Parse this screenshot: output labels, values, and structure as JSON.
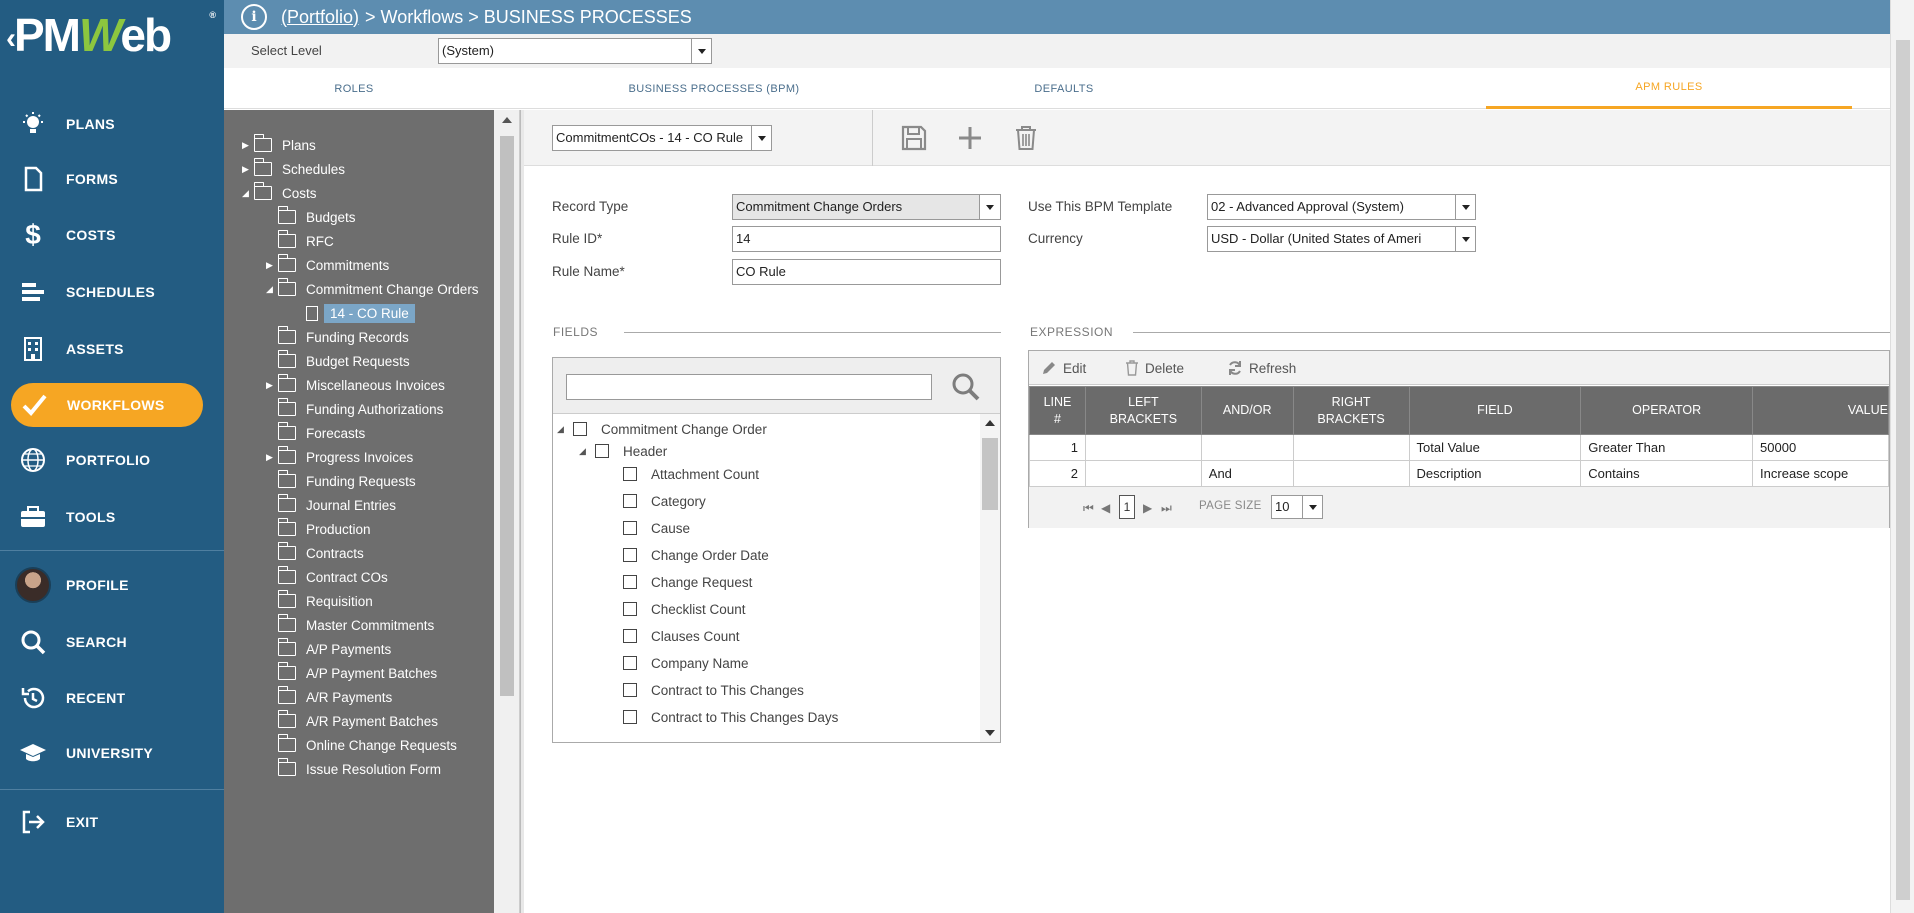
{
  "nav": {
    "items": [
      {
        "label": "PLANS",
        "icon": "lightbulb-icon"
      },
      {
        "label": "FORMS",
        "icon": "document-icon"
      },
      {
        "label": "COSTS",
        "icon": "dollar-icon"
      },
      {
        "label": "SCHEDULES",
        "icon": "schedule-bars-icon"
      },
      {
        "label": "ASSETS",
        "icon": "building-icon"
      },
      {
        "label": "WORKFLOWS",
        "icon": "checkmark-icon"
      },
      {
        "label": "PORTFOLIO",
        "icon": "globe-icon"
      },
      {
        "label": "TOOLS",
        "icon": "briefcase-icon"
      },
      {
        "label": "PROFILE",
        "icon": "avatar"
      },
      {
        "label": "SEARCH",
        "icon": "search-icon"
      },
      {
        "label": "RECENT",
        "icon": "history-icon"
      },
      {
        "label": "UNIVERSITY",
        "icon": "graduation-cap-icon"
      },
      {
        "label": "EXIT",
        "icon": "exit-icon"
      }
    ],
    "active": "WORKFLOWS",
    "logo_text": "PMWeb",
    "logo_mark": "®"
  },
  "header": {
    "portfolio_link": "(Portfolio)",
    "breadcrumb_rest": "> Workflows > BUSINESS PROCESSES"
  },
  "level": {
    "label": "Select Level",
    "value": "(System)"
  },
  "tabs": [
    {
      "label": "ROLES"
    },
    {
      "label": "BUSINESS PROCESSES (BPM)"
    },
    {
      "label": "DEFAULTS"
    },
    {
      "label": "APM RULES"
    }
  ],
  "tree": {
    "items": [
      {
        "label": "Plans"
      },
      {
        "label": "Schedules"
      },
      {
        "label": "Costs"
      },
      {
        "label": "Budgets"
      },
      {
        "label": "RFC"
      },
      {
        "label": "Commitments"
      },
      {
        "label": "Commitment Change Orders"
      },
      {
        "label": "14 - CO Rule"
      },
      {
        "label": "Funding Records"
      },
      {
        "label": "Budget Requests"
      },
      {
        "label": "Miscellaneous Invoices"
      },
      {
        "label": "Funding Authorizations"
      },
      {
        "label": "Forecasts"
      },
      {
        "label": "Progress Invoices"
      },
      {
        "label": "Funding Requests"
      },
      {
        "label": "Journal Entries"
      },
      {
        "label": "Production"
      },
      {
        "label": "Contracts"
      },
      {
        "label": "Contract COs"
      },
      {
        "label": "Requisition"
      },
      {
        "label": "Master Commitments"
      },
      {
        "label": "A/P Payments"
      },
      {
        "label": "A/P Payment Batches"
      },
      {
        "label": "A/R Payments"
      },
      {
        "label": "A/R Payment Batches"
      },
      {
        "label": "Online Change Requests"
      },
      {
        "label": "Issue Resolution Form"
      }
    ]
  },
  "toolbar": {
    "rule_select": "CommitmentCOs - 14 - CO Rule"
  },
  "form": {
    "record_type_label": "Record Type",
    "record_type_value": "Commitment Change Orders",
    "rule_id_label": "Rule ID*",
    "rule_id_value": "14",
    "rule_name_label": "Rule Name*",
    "rule_name_value": "CO Rule",
    "bpm_template_label": "Use This BPM Template",
    "bpm_template_value": "02 - Advanced Approval (System)",
    "currency_label": "Currency",
    "currency_value": "USD - Dollar (United States of Ameri"
  },
  "fields": {
    "title": "FIELDS",
    "search_value": "",
    "items": [
      {
        "label": "Commitment Change Order"
      },
      {
        "label": "Header"
      },
      {
        "label": "Attachment Count"
      },
      {
        "label": "Category"
      },
      {
        "label": "Cause"
      },
      {
        "label": "Change Order Date"
      },
      {
        "label": "Change Request"
      },
      {
        "label": "Checklist Count"
      },
      {
        "label": "Clauses Count"
      },
      {
        "label": "Company Name"
      },
      {
        "label": "Contract to This Changes"
      },
      {
        "label": "Contract to This Changes Days"
      }
    ]
  },
  "expression": {
    "title": "EXPRESSION",
    "edit_label": "Edit",
    "delete_label": "Delete",
    "refresh_label": "Refresh",
    "columns": {
      "line_1": "LINE",
      "line_2": "#",
      "left_1": "LEFT",
      "left_2": "BRACKETS",
      "andor": "AND/OR",
      "right_1": "RIGHT",
      "right_2": "BRACKETS",
      "field": "FIELD",
      "operator": "OPERATOR",
      "value": "VALUE"
    },
    "rows": [
      {
        "line": "1",
        "left": "",
        "andor": "",
        "right": "",
        "field": "Total Value",
        "operator": "Greater Than",
        "value": "50000"
      },
      {
        "line": "2",
        "left": "",
        "andor": "And",
        "right": "",
        "field": "Description",
        "operator": "Contains",
        "value": "Increase scope"
      }
    ],
    "page_label": "1",
    "page_size_label": "PAGE SIZE",
    "page_size_value": "10"
  },
  "colors": {
    "nav_bg": "#235c82",
    "active_accent": "#f6a623",
    "header_bg": "#5d8db0",
    "tree_bg": "#6e6e6e"
  }
}
